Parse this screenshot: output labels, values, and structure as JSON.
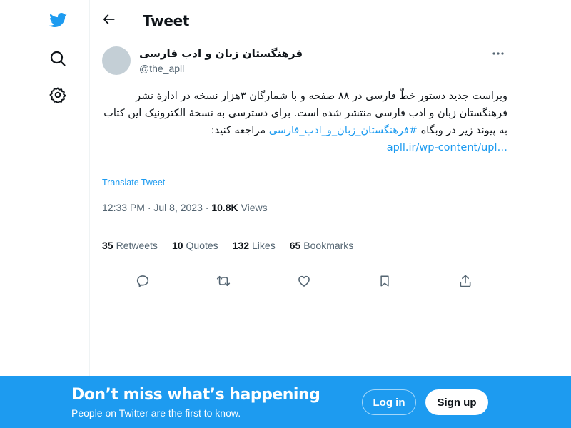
{
  "header": {
    "title": "Tweet"
  },
  "tweet": {
    "author_name": "فرهنگستان زبان و ادب فارسی",
    "author_handle": "@the_apll",
    "text_part1": "ویراست جدید دستور خطّ فارسی در ۸۸ صفحه و با شمارگان ۳هزار نسخه در ادارهٔ نشر فرهنگستان زبان و ادب فارسی منتشر شده است. برای دسترسی به نسخهٔ الکترونیک این کتاب به پیوند زیر در وبگاه ",
    "hashtag": "#فرهنگستان_زبان_و_ادب_فارسی",
    "text_part2": " مراجعه کنید:",
    "link": "apll.ir/wp-content/upl…",
    "translate_label": "Translate Tweet",
    "timestamp": "12:33 PM · Jul 8, 2023 · ",
    "views_count": "10.8K",
    "views_label": " Views"
  },
  "stats": {
    "retweets_count": "35",
    "retweets_label": "Retweets",
    "quotes_count": "10",
    "quotes_label": "Quotes",
    "likes_count": "132",
    "likes_label": "Likes",
    "bookmarks_count": "65",
    "bookmarks_label": "Bookmarks"
  },
  "banner": {
    "title": "Don’t miss what’s happening",
    "subtitle": "People on Twitter are the first to know.",
    "login_label": "Log in",
    "signup_label": "Sign up"
  },
  "colors": {
    "accent": "#1d9bf0",
    "text": "#0f1419",
    "muted": "#536471",
    "avatar": "#c4cfd6"
  },
  "icons": {
    "logo": "twitter-bird-icon",
    "explore": "search-icon",
    "settings": "gear-icon",
    "back": "arrow-left-icon",
    "more": "more-horizontal-icon",
    "reply": "reply-icon",
    "retweet": "retweet-icon",
    "like": "heart-icon",
    "bookmark": "bookmark-icon",
    "share": "share-icon"
  }
}
